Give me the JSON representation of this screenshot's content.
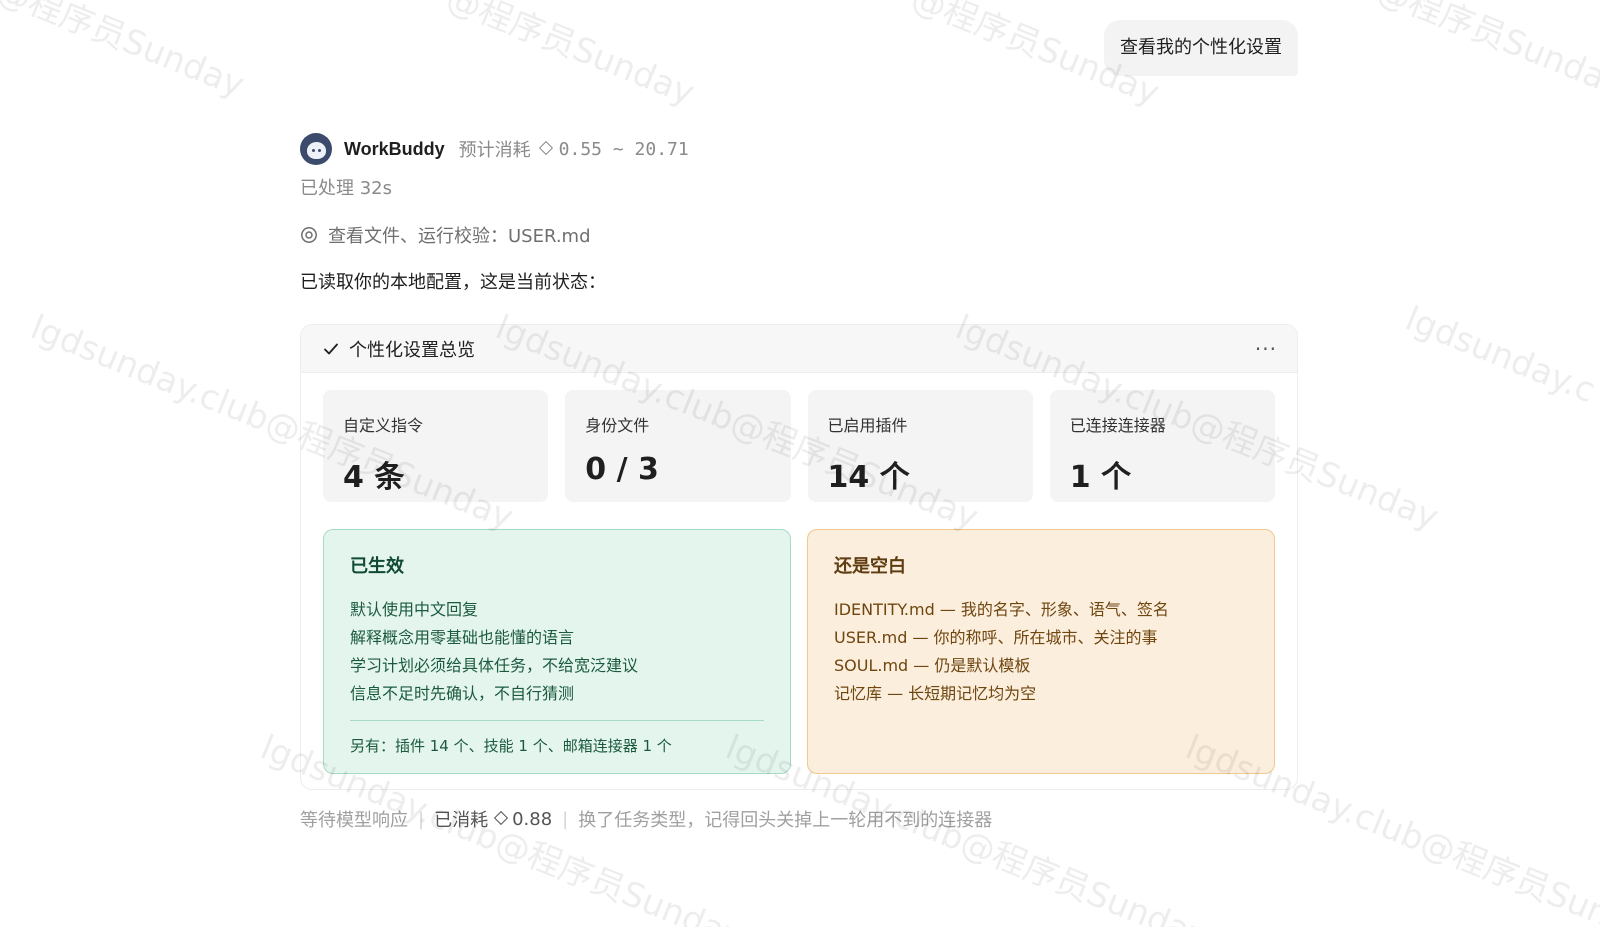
{
  "user_message": "查看我的个性化设置",
  "assistant": {
    "name": "WorkBuddy",
    "cost_label": "预计消耗",
    "cost_range": "0.55 ~ 20.71",
    "processed": "已处理 32s",
    "action": "查看文件、运行校验：USER.md",
    "intro": "已读取你的本地配置，这是当前状态："
  },
  "card": {
    "title": "个性化设置总览",
    "more_label": "···",
    "stats": [
      {
        "label": "自定义指令",
        "value": "4 条"
      },
      {
        "label": "身份文件",
        "value": "0 / 3"
      },
      {
        "label": "已启用插件",
        "value": "14 个"
      },
      {
        "label": "已连接连接器",
        "value": "1 个"
      }
    ],
    "active_panel": {
      "title": "已生效",
      "items": [
        "默认使用中文回复",
        "解释概念用零基础也能懂的语言",
        "学习计划必须给具体任务，不给宽泛建议",
        "信息不足时先确认，不自行猜测"
      ],
      "footer": "另有：插件 14 个、技能 1 个、邮箱连接器 1 个"
    },
    "empty_panel": {
      "title": "还是空白",
      "items": [
        "IDENTITY.md — 我的名字、形象、语气、签名",
        "USER.md — 你的称呼、所在城市、关注的事",
        "SOUL.md — 仍是默认模板",
        "记忆库 — 长短期记忆均为空"
      ]
    }
  },
  "footer": {
    "status": "等待模型响应",
    "consumed_label": "已消耗",
    "consumed_value": "0.88",
    "tip": "换了任务类型，记得回头关掉上一轮用不到的连接器"
  },
  "watermarks": {
    "a": "@程序员Sunday",
    "b": "lgdsunday.club@程序员Sunday",
    "c": "lgdsunday.c"
  }
}
